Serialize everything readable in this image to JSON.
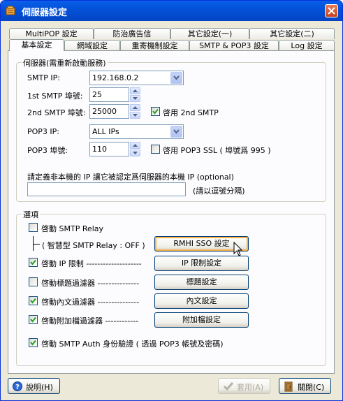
{
  "window": {
    "title": "伺服器設定"
  },
  "tabs_row1": [
    "MultiPOP 設定",
    "防治廣告信",
    "其它設定(一)",
    "其它設定(二)"
  ],
  "tabs_row2": [
    "基本設定",
    "網域設定",
    "重寄機制設定",
    "SMTP & POP3  設定",
    "Log 設定"
  ],
  "active_tab": "基本設定",
  "server_group": {
    "legend": "伺服器(需重新啟動服務)",
    "smtp_ip_label": "SMTP IP:",
    "smtp_ip_value": "192.168.0.2",
    "smtp_port1_label": "1st SMTP 埠號:",
    "smtp_port1_value": "25",
    "smtp_port2_label": "2nd SMTP 埠號:",
    "smtp_port2_value": "25000",
    "enable_2nd_smtp_label": "啓用 2nd SMTP",
    "enable_2nd_smtp_checked": true,
    "pop3_ip_label": "POP3 IP:",
    "pop3_ip_value": "ALL IPs",
    "pop3_port_label": "POP3 埠號:",
    "pop3_port_value": "110",
    "pop3_ssl_label": "啓用 POP3 SSL ( 埠號爲 995 )",
    "pop3_ssl_checked": false,
    "nonlocal_ip_desc": "請定義非本機的 IP 讓它被認定爲伺服器的本機 IP (optional)",
    "nonlocal_ip_value": "",
    "nonlocal_ip_hint": "(請以逗號分隔)"
  },
  "options_group": {
    "legend": "選項",
    "smtp_relay_label": "啓動 SMTP Relay",
    "smtp_relay_checked": false,
    "smart_relay_label": "( 智慧型 SMTP Relay : OFF )",
    "rmhi_button": "RMHI SSO 設定",
    "ip_limit_label": "啓動 IP 限制 --------------------",
    "ip_limit_checked": true,
    "ip_limit_button": "IP 限制設定",
    "subject_filter_label": "啓動標題過濾器 ---------------",
    "subject_filter_checked": false,
    "subject_filter_button": "標題設定",
    "body_filter_label": "啓動內文過濾器 ---------------",
    "body_filter_checked": true,
    "body_filter_button": "內文設定",
    "attach_filter_label": "啓動附加檔過濾器 ------------",
    "attach_filter_checked": true,
    "attach_filter_button": "附加檔設定",
    "smtp_auth_label": "啓動 SMTP Auth 身份驗證 ( 透過 POP3 帳號及密碼)",
    "smtp_auth_checked": true
  },
  "footer": {
    "help_button": "說明(H)",
    "apply_button": "套用(A)",
    "close_button": "關閉(C)"
  },
  "colors": {
    "titlebar": "#0352d8",
    "dialog_bg": "#ece9d8",
    "check_green": "#21a121"
  }
}
